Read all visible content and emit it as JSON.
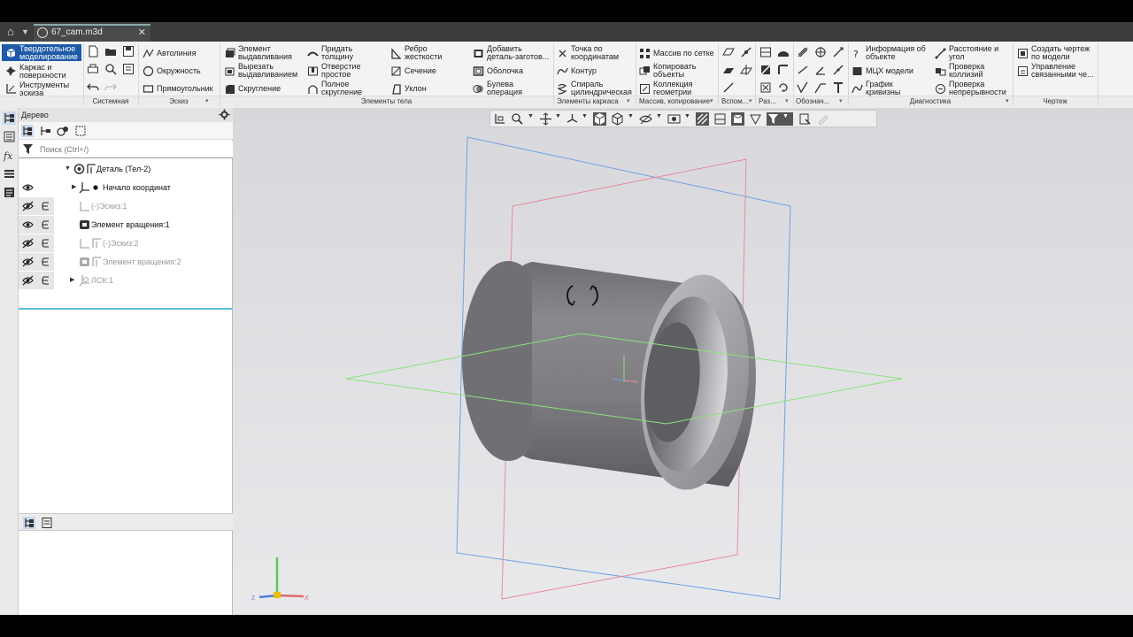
{
  "tab": {
    "title": "67_cam.m3d"
  },
  "ribbon": {
    "modes": [
      "Твердотельное моделирование",
      "Каркас и поверхности",
      "Инструменты эскиза"
    ],
    "sketch": [
      "Автолиния",
      "Окружность",
      "Прямоугольник"
    ],
    "body": [
      [
        "Элемент выдавливания",
        "Вырезать выдавливанием",
        "Скругление"
      ],
      [
        "Придать толщину",
        "Отверстие простое",
        "Полное скругление"
      ],
      [
        "Ребро жесткости",
        "Сечение",
        "Уклон"
      ],
      [
        "Добавить деталь-заготов...",
        "Оболочка",
        "Булева операция"
      ]
    ],
    "frame": [
      "Точка по координатам",
      "Контур",
      "Спираль цилиндрическая"
    ],
    "array": [
      "Массив по сетке",
      "Копировать объекты",
      "Коллекция геометрии"
    ],
    "diag": [
      "Информация об объекте",
      "МЦХ модели",
      "График кривизны",
      "Расстояние и угол",
      "Проверка коллизий",
      "Проверка непрерывности"
    ],
    "drawing": [
      "Создать чертеж по модели",
      "Управление связанными че..."
    ],
    "groups": [
      "Системная",
      "Эскиз",
      "Элементы тела",
      "Элементы каркаса",
      "Массив, копирование",
      "Вспом...",
      "Раз...",
      "Обознач...",
      "Диагностика",
      "Чертеж"
    ]
  },
  "tree": {
    "title": "Дерево",
    "search_placeholder": "Поиск (Ctrl+/)",
    "rows": [
      {
        "label": "Деталь (Тел-2)"
      },
      {
        "label": "Начало координат"
      },
      {
        "label": "(-)Эскиз:1"
      },
      {
        "label": "Элемент вращения:1"
      },
      {
        "label": "(-)Эскиз:2"
      },
      {
        "label": "Элемент вращения:2"
      },
      {
        "label": "ЛСК:1"
      }
    ]
  },
  "axes": {
    "z": "Z",
    "x": "X"
  },
  "colors": {
    "accent": "#1e5aa8",
    "tabbar": "#3c3c3c",
    "plane_blue": "#6fa0e0",
    "plane_red": "#e88aa0",
    "plane_green": "#8ee07a"
  }
}
